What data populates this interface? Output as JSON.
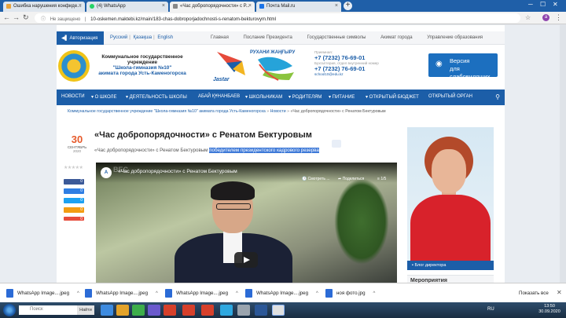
{
  "browser": {
    "tabs": [
      {
        "title": "Ошибка нарушения конфиде...",
        "icon": "warning-icon",
        "color": "#e8a33d"
      },
      {
        "title": "(4) WhatsApp",
        "icon": "whatsapp-icon",
        "color": "#25d366"
      },
      {
        "title": "«Час добропорядочности» с Р...",
        "icon": "globe-icon",
        "color": "#888888"
      },
      {
        "title": "Почта Mail.ru",
        "icon": "mail-icon",
        "color": "#1a73e8"
      }
    ],
    "new_tab": "+",
    "address": {
      "security": "Не защищено",
      "url": "10-oskemen.maktebi.kz/main/183-chas-dobroporjadochnosti-s-renatom-bekturovym.html"
    },
    "profile_initial": "a"
  },
  "site": {
    "auth_button": "Авторизация",
    "languages": [
      "Русский",
      "Қазақша",
      "English"
    ],
    "top_links": [
      "Главная",
      "Послание Президента",
      "Государственные символы",
      "Акимат города",
      "Управление образования"
    ],
    "school_name": {
      "line1": "Коммунальное государственное учреждение",
      "line2": "\"Школа-гимназия №10\"",
      "line3": "акимата города Усть-Каменогорска"
    },
    "logo_text": {
      "top": "РУХАНИ ЖАҢҒЫРУ",
      "bottom": "Jastar"
    },
    "contacts": {
      "label1": "Приемная:",
      "phone1": "+7 (7232) 76-69-01",
      "label2": "Бухгалтерия, отдел внутренний номер",
      "phone2": "+7 (7232) 76-69-01",
      "email": "school10@edu.kz"
    },
    "version_button": {
      "line1": "Версия",
      "line2": "для слабовидящих"
    },
    "nav": [
      {
        "label": "НОВОСТИ",
        "orange": false
      },
      {
        "label": "▾ О ШКОЛЕ",
        "orange": false
      },
      {
        "label": "▾ ДЕЯТЕЛЬНОСТЬ ШКОЛЫ",
        "orange": false
      },
      {
        "label": "АБАЙ ҚҰНАНБАЕВ",
        "orange": false
      },
      {
        "label": "▾ ШКОЛЬНИКАМ",
        "orange": false
      },
      {
        "label": "▾ РОДИТЕЛЯМ",
        "orange": false
      },
      {
        "label": "▾ ПИТАНИЕ",
        "orange": false
      },
      {
        "label": "▾ ОТКРЫТЫЙ БЮДЖЕТ",
        "orange": false
      },
      {
        "label": "ОТКРЫТЫЙ ОРГАН",
        "orange": false
      }
    ],
    "breadcrumbs": [
      "Коммунальное государственное учреждение \"Школа-гимназия №10\" акимата города Усть-Каменогорска",
      "Новости",
      "«Час добропорядочности» с Ренатом Бектуровым"
    ],
    "breadcrumb_sep": "»",
    "date": {
      "day": "30",
      "month": "СЕНТЯБРЬ",
      "year": "2020"
    },
    "rating_stars": "★★★★★",
    "share_counts": [
      "0",
      "0",
      "0",
      "0",
      "0"
    ],
    "share_colors": [
      "#3b5998",
      "#2f7ee3",
      "#1da1f2",
      "#f39c12",
      "#e74c3c"
    ],
    "article": {
      "title": "«Час добропорядочности» с Ренатом Бектуровым",
      "lead": "«Час добропорядочности» с Ренатом Бектуровым",
      "lead_highlight": "победителем президентского кадрового резерва"
    },
    "video": {
      "title": "«Час добропорядочности» с Ренатом Бектуровым",
      "brand": "ВЕС",
      "watch_later": "Смотреть ...",
      "share": "Поделиться",
      "playlist": "1/5"
    },
    "blog_label": "Блог директора",
    "events_heading": "Мероприятия"
  },
  "downloads": {
    "items": [
      "WhatsApp Image....jpeg",
      "WhatsApp Image....jpeg",
      "WhatsApp Image....jpeg",
      "WhatsApp Image....jpeg",
      "ноя фото.jpg"
    ],
    "show_all": "Показать все"
  },
  "taskbar": {
    "search_placeholder": "Поиск",
    "search_button": "Найти",
    "tray_lang": "RU",
    "time": "13:50",
    "date": "30.09.2020"
  }
}
